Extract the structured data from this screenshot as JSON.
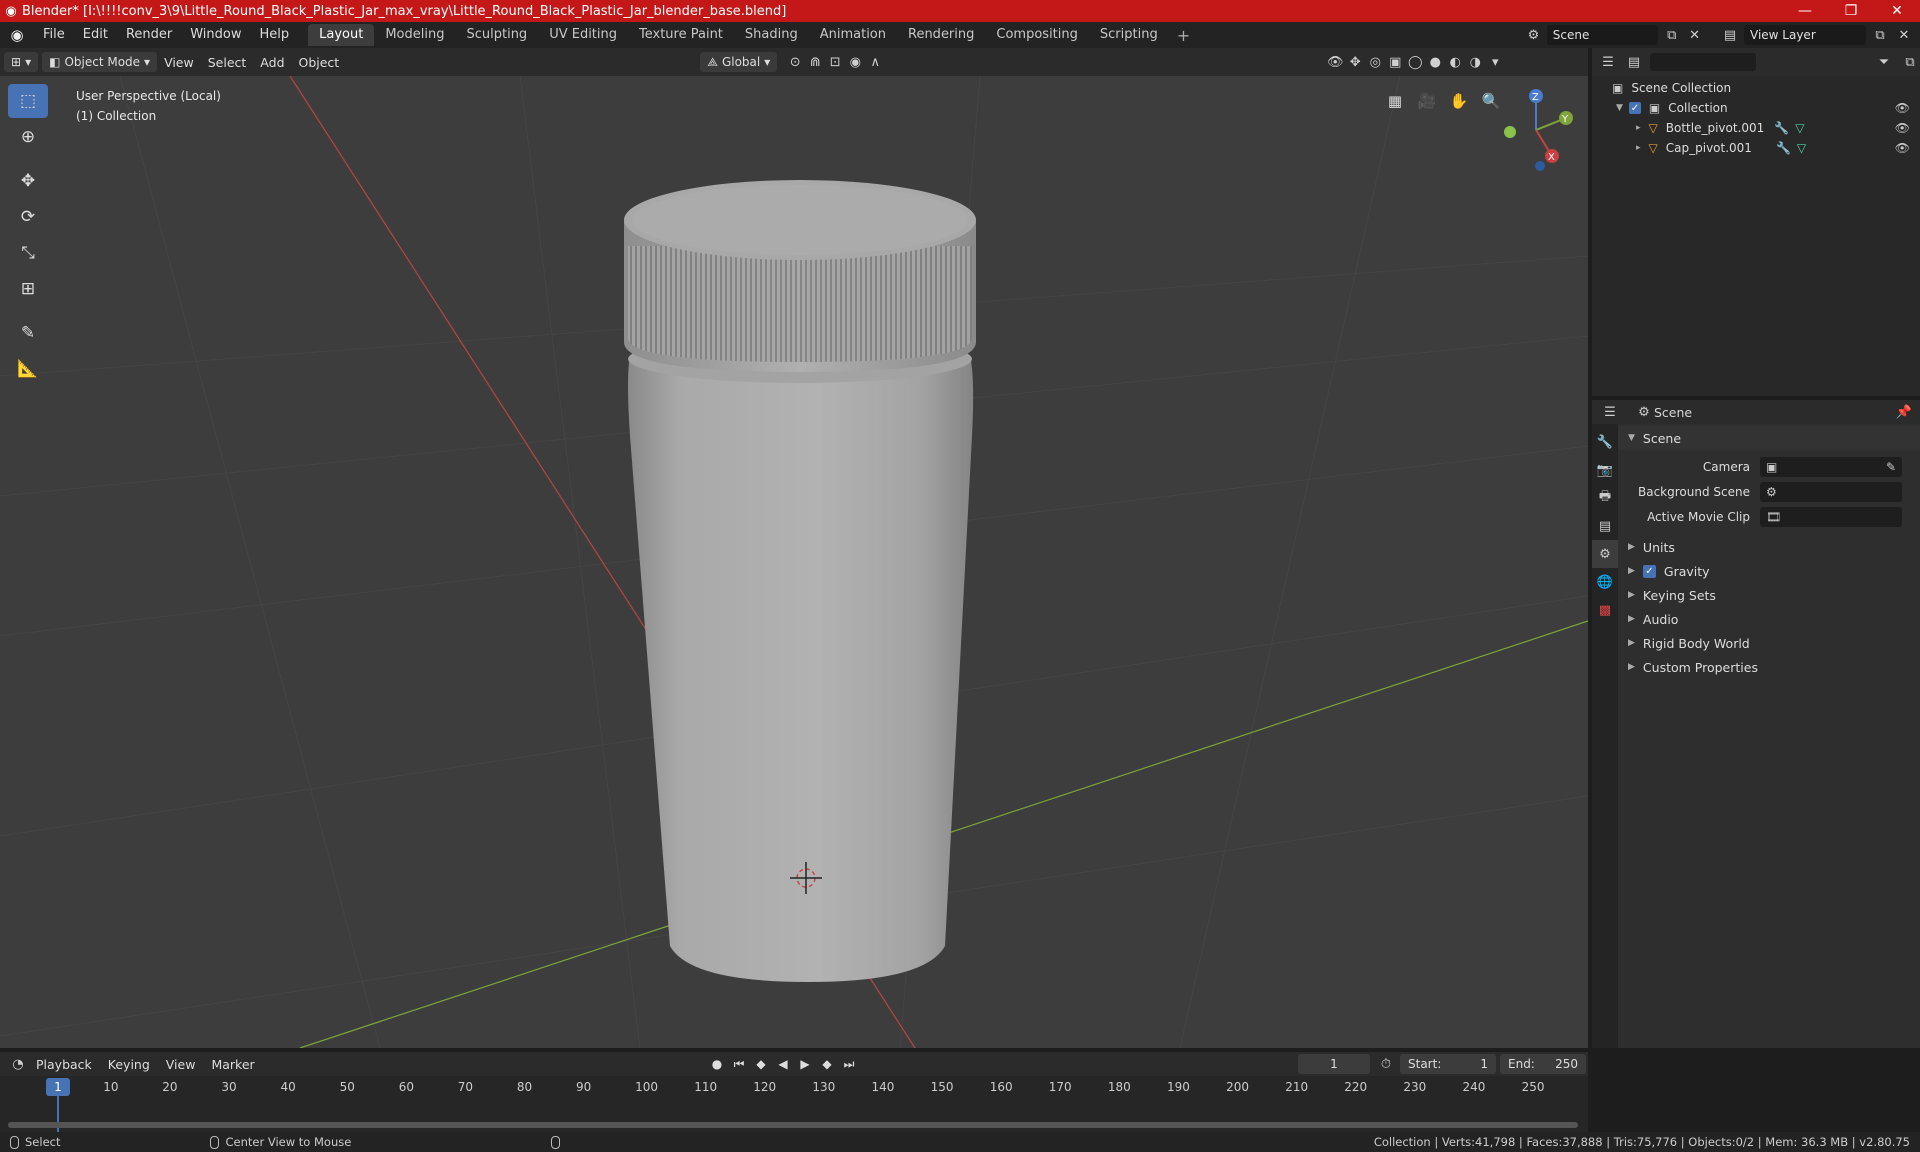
{
  "window": {
    "title": "Blender* [I:\\!!!!conv_3\\9\\Little_Round_Black_Plastic_Jar_max_vray\\Little_Round_Black_Plastic_Jar_blender_base.blend]",
    "minimize": "—",
    "maximize": "❐",
    "close": "✕"
  },
  "menu": {
    "items": [
      "File",
      "Edit",
      "Render",
      "Window",
      "Help"
    ]
  },
  "workspaces": {
    "tabs": [
      "Layout",
      "Modeling",
      "Sculpting",
      "UV Editing",
      "Texture Paint",
      "Shading",
      "Animation",
      "Rendering",
      "Compositing",
      "Scripting"
    ],
    "active": "Layout",
    "add": "+"
  },
  "scene_selector": {
    "value": "Scene"
  },
  "view_layer_selector": {
    "value": "View Layer"
  },
  "viewport_header": {
    "mode": "Object Mode",
    "menus": [
      "View",
      "Select",
      "Add",
      "Object"
    ],
    "transform_orientation": "Global"
  },
  "viewport": {
    "perspective_label": "User Perspective (Local)",
    "collection_label": "(1) Collection",
    "axis_labels": {
      "x": "X",
      "y": "Y",
      "z": "Z"
    }
  },
  "outliner": {
    "search_placeholder": "",
    "scene_collection": "Scene Collection",
    "collection": "Collection",
    "objects": [
      "Bottle_pivot.001",
      "Cap_pivot.001"
    ]
  },
  "properties": {
    "context": "Scene",
    "panel": "Scene",
    "camera_label": "Camera",
    "background_scene_label": "Background Scene",
    "active_movie_clip_label": "Active Movie Clip",
    "subpanels": [
      "Units",
      "Gravity",
      "Keying Sets",
      "Audio",
      "Rigid Body World",
      "Custom Properties"
    ]
  },
  "timeline": {
    "menus": [
      "Playback",
      "Keying",
      "View",
      "Marker"
    ],
    "current_frame": "1",
    "start_label": "Start:",
    "start_value": "1",
    "end_label": "End:",
    "end_value": "250",
    "ruler": [
      "10",
      "20",
      "30",
      "40",
      "50",
      "60",
      "70",
      "80",
      "90",
      "100",
      "110",
      "120",
      "130",
      "140",
      "150",
      "160",
      "170",
      "180",
      "190",
      "200",
      "210",
      "220",
      "230",
      "240",
      "250"
    ],
    "ruler_current": "1"
  },
  "statusbar": {
    "select_hint": "Select",
    "center_hint": "Center View to Mouse",
    "stats": "Collection | Verts:41,798 | Faces:37,888 | Tris:75,776 | Objects:0/2 | Mem: 36.3 MB | v2.80.75"
  },
  "colors": {
    "title_bar": "#c41717",
    "accent": "#4772b3",
    "viewport_bg": "#3d3d3d",
    "x_axis": "#c84040",
    "y_axis": "#7ea43a"
  }
}
